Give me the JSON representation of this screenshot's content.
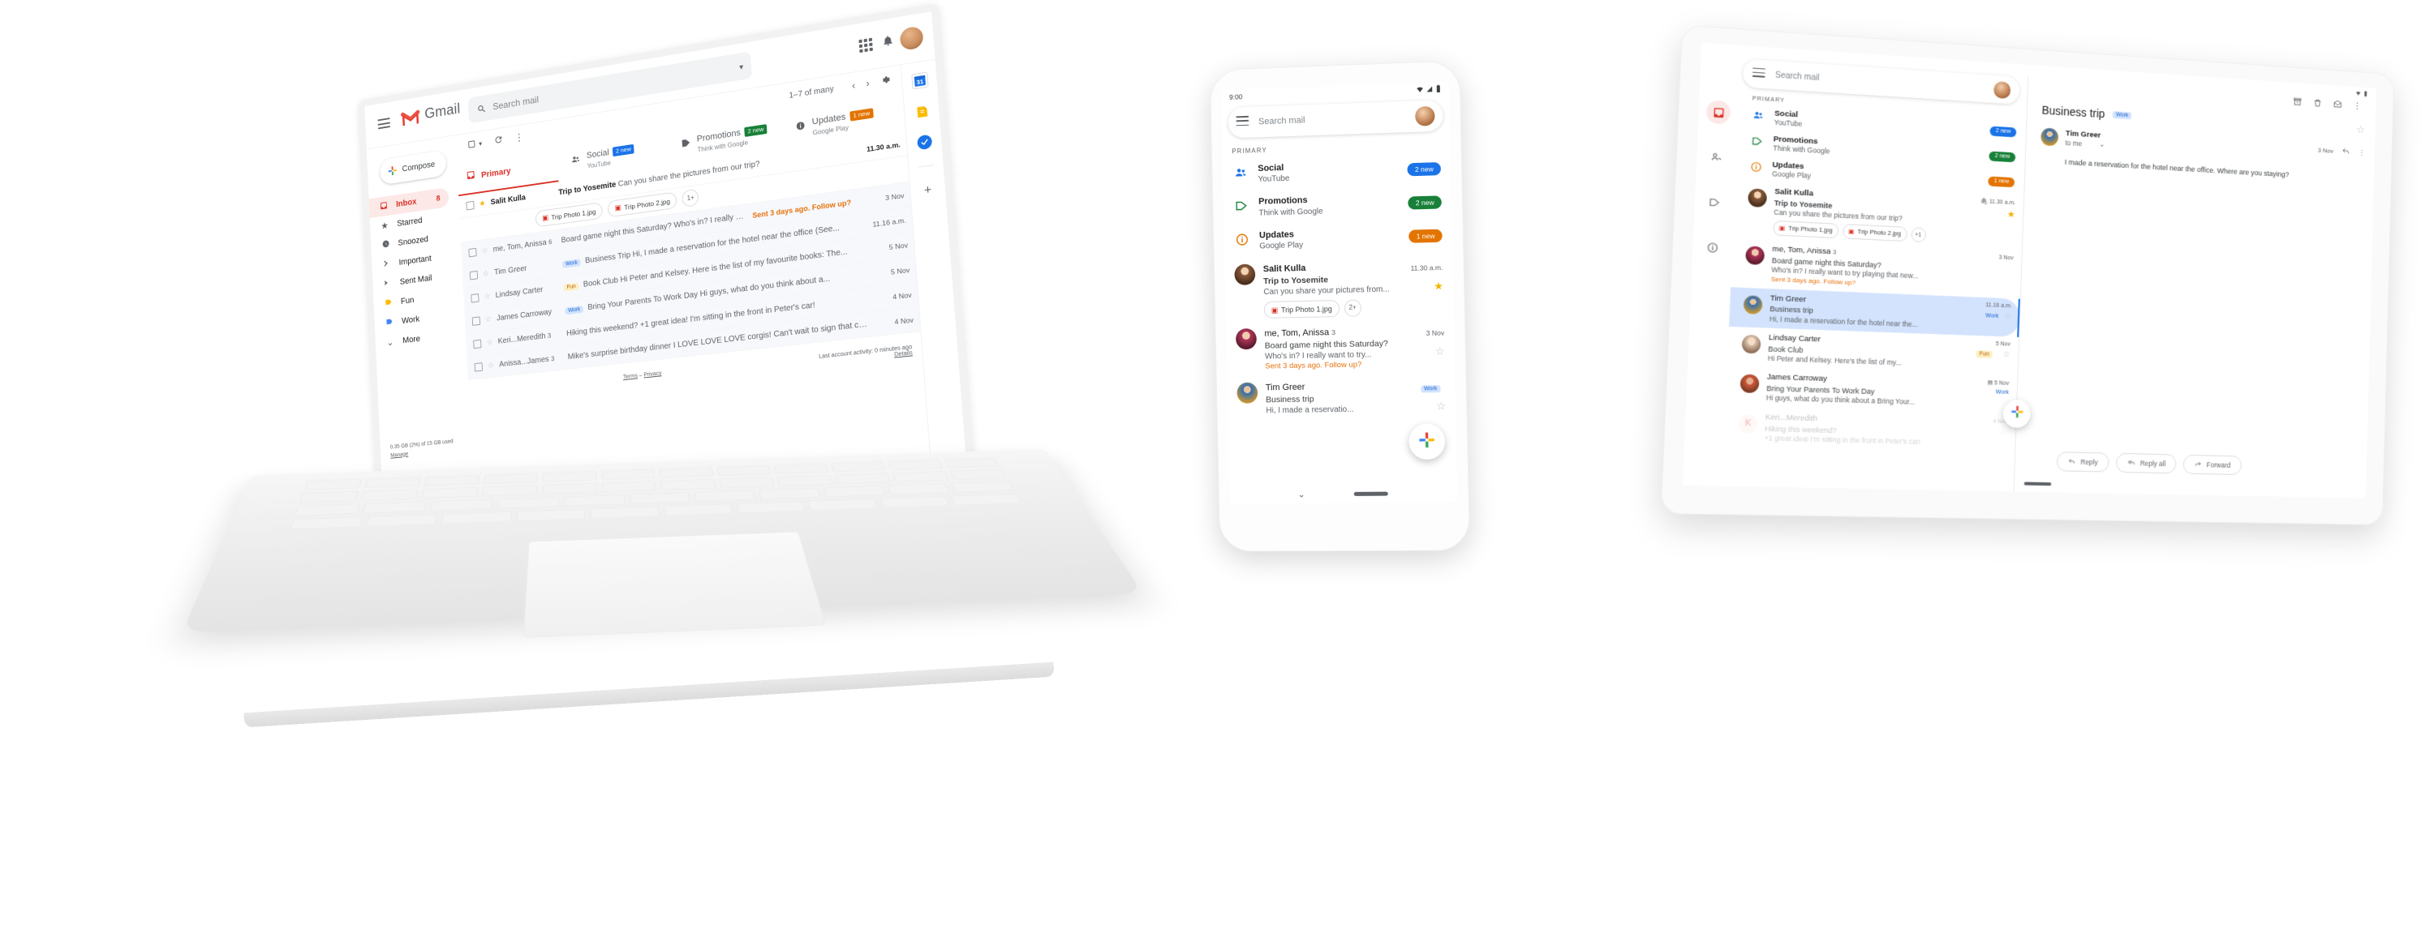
{
  "brand": {
    "app_name": "Gmail",
    "colors": {
      "red": "#d93025",
      "blue": "#1a73e8",
      "green": "#188038",
      "orange": "#e37400",
      "yellow": "#f4b400",
      "nudge_orange": "#e8710a",
      "work_label_bg": "#d3e3fd",
      "work_label_fg": "#1967d2",
      "fun_label_bg": "#feefc3",
      "fun_label_fg": "#b06000"
    }
  },
  "desktop": {
    "search": {
      "placeholder": "Search mail",
      "icon": "search-icon"
    },
    "menu_icon": "hamburger-menu-icon",
    "apps_icon": "apps-grid-icon",
    "notifications_icon": "bell-icon",
    "account_avatar": "user-avatar",
    "compose": {
      "label": "Compose",
      "icon": "plus-icon"
    },
    "sidebar": [
      {
        "label": "Inbox",
        "icon": "inbox-icon",
        "count": "8",
        "active": true
      },
      {
        "label": "Starred",
        "icon": "star-icon",
        "count": ""
      },
      {
        "label": "Snoozed",
        "icon": "clock-icon",
        "count": ""
      },
      {
        "label": "Important",
        "icon": "important-icon",
        "count": ""
      },
      {
        "label": "Sent Mail",
        "icon": "send-icon",
        "count": ""
      },
      {
        "label": "Fun",
        "icon": "label-yellow-icon",
        "count": ""
      },
      {
        "label": "Work",
        "icon": "label-blue-icon",
        "count": ""
      },
      {
        "label": "More",
        "icon": "chevron-down-icon",
        "count": ""
      }
    ],
    "storage": {
      "text": "0.35 GB (2%) of 15 GB used",
      "manage": "Manage"
    },
    "footer_icons": [
      "contacts-icon",
      "location-icon",
      "phone-icon"
    ],
    "toolbar": {
      "select_icon": "select-all-checkbox-icon",
      "select_caret": "chevron-down-icon",
      "refresh_icon": "refresh-icon",
      "more_icon": "more-vertical-icon",
      "count": "1–7 of many",
      "prev_icon": "chevron-left-icon",
      "next_icon": "chevron-right-icon",
      "settings_icon": "gear-icon"
    },
    "tabs": [
      {
        "label": "Primary",
        "sub": "",
        "badge": "",
        "badge_color": "",
        "icon": "inbox-icon",
        "selected": true
      },
      {
        "label": "Social",
        "sub": "YouTube",
        "badge": "2 new",
        "badge_color": "#1a73e8",
        "icon": "people-icon",
        "selected": false
      },
      {
        "label": "Promotions",
        "sub": "Think with Google",
        "badge": "2 new",
        "badge_color": "#188038",
        "icon": "tag-icon",
        "selected": false
      },
      {
        "label": "Updates",
        "sub": "Google Play",
        "badge": "1 new",
        "badge_color": "#e37400",
        "icon": "info-icon",
        "selected": false
      }
    ],
    "threads": [
      {
        "from": "Salit Kulla",
        "count": "",
        "starred": true,
        "unread": true,
        "label": "",
        "subject": "Trip to Yosemite",
        "snippet": "Can you share the pictures from our trip?",
        "date": "11.30 a.m.",
        "nudge": "",
        "attachments": [
          "Trip Photo 1.jpg",
          "Trip Photo 2.jpg"
        ],
        "attachments_more": "1+"
      },
      {
        "from": "me, Tom, Anissa",
        "count": "6",
        "starred": false,
        "unread": false,
        "label": "",
        "subject": "Board game night this Saturday?",
        "snippet": "Who's in? I really want to try...",
        "date": "3 Nov",
        "nudge": "Sent 3 days ago. Follow up?",
        "attachments": [],
        "attachments_more": ""
      },
      {
        "from": "Tim Greer",
        "count": "",
        "starred": false,
        "unread": false,
        "label": "Work",
        "subject": "Business Trip",
        "snippet": "Hi, I made a reservation for the hotel near the office (See...",
        "date": "11.16 a.m.",
        "nudge": "",
        "attachments": [],
        "attachments_more": ""
      },
      {
        "from": "Lindsay Carter",
        "count": "",
        "starred": false,
        "unread": false,
        "label": "Fun",
        "subject": "Book Club",
        "snippet": "Hi Peter and Kelsey. Here is the list of my favourite books: The...",
        "date": "5 Nov",
        "nudge": "",
        "attachments": [],
        "attachments_more": ""
      },
      {
        "from": "James Carroway",
        "count": "",
        "starred": false,
        "unread": false,
        "label": "Work",
        "subject": "Bring Your Parents To Work Day",
        "snippet": "Hi guys, what do you think about a...",
        "date": "5 Nov",
        "nudge": "",
        "attachments": [],
        "attachments_more": ""
      },
      {
        "from": "Keri...Meredith",
        "count": "3",
        "starred": false,
        "unread": false,
        "label": "",
        "subject": "Hiking this weekend?",
        "snippet": "+1 great idea! I'm sitting in the front in Peter's car!",
        "date": "4 Nov",
        "nudge": "",
        "attachments": [],
        "attachments_more": ""
      },
      {
        "from": "Anissa...James",
        "count": "3",
        "starred": false,
        "unread": false,
        "label": "",
        "subject": "Mike's surprise birthday dinner",
        "snippet": "I LOVE LOVE LOVE corgis! Can't wait to sign that card.",
        "date": "4 Nov",
        "nudge": "",
        "attachments": [],
        "attachments_more": ""
      }
    ],
    "list_footer": {
      "terms": "Terms",
      "separator": "–",
      "privacy": "Privacy",
      "activity": "Last account activity: 0 minutes ago",
      "details": "Details"
    },
    "side_panel": [
      {
        "icon": "google-calendar-icon",
        "label": "31"
      },
      {
        "icon": "google-keep-icon",
        "label": ""
      },
      {
        "icon": "google-tasks-icon",
        "label": ""
      }
    ],
    "side_panel_add": {
      "icon": "plus-icon",
      "label": "+"
    }
  },
  "phone": {
    "status": {
      "time": "9:00",
      "wifi": "wifi-icon",
      "signal": "signal-icon",
      "battery": "battery-icon"
    },
    "search": {
      "placeholder": "Search mail",
      "menu_icon": "hamburger-menu-icon",
      "avatar": "user-avatar"
    },
    "section": "PRIMARY",
    "bundles": [
      {
        "name": "Social",
        "sender": "YouTube",
        "badge": "2 new",
        "color": "#1a73e8",
        "icon": "people-icon"
      },
      {
        "name": "Promotions",
        "sender": "Think with Google",
        "badge": "2 new",
        "color": "#188038",
        "icon": "tag-icon"
      },
      {
        "name": "Updates",
        "sender": "Google Play",
        "badge": "1 new",
        "color": "#e37400",
        "icon": "info-icon"
      }
    ],
    "threads": [
      {
        "from": "Salit Kulla",
        "count": "",
        "subject": "Trip to Yosemite",
        "snippet": "Can you share your pictures from...",
        "date": "11.30 a.m.",
        "starred": true,
        "unread": true,
        "nudge": "",
        "label": "",
        "attachments": [
          "Trip Photo 1.jpg"
        ],
        "attachments_more": "2+"
      },
      {
        "from": "me, Tom, Anissa",
        "count": "3",
        "subject": "Board game night this Saturday?",
        "snippet": "Who's in? I really want to try...",
        "date": "3 Nov",
        "starred": false,
        "unread": false,
        "nudge": "Sent 3 days ago. Follow up?",
        "label": "",
        "attachments": [],
        "attachments_more": ""
      },
      {
        "from": "Tim Greer",
        "count": "",
        "subject": "Business trip",
        "snippet": "Hi, I made a reservatio...",
        "date": "",
        "starred": false,
        "unread": false,
        "nudge": "",
        "label": "Work",
        "attachments": [],
        "attachments_more": ""
      }
    ],
    "fab": {
      "icon": "compose-plus-icon"
    },
    "nav": {
      "chevron": "chevron-down-icon",
      "home_indicator": "home-pill"
    }
  },
  "tablet": {
    "search": {
      "placeholder": "Search mail",
      "menu_icon": "hamburger-menu-icon",
      "avatar": "user-avatar"
    },
    "rail": [
      "inbox-icon",
      "people-icon",
      "tag-icon",
      "info-icon"
    ],
    "section": "PRIMARY",
    "bundles": [
      {
        "name": "Social",
        "sender": "YouTube",
        "badge": "2 new",
        "color": "#1a73e8",
        "icon": "people-icon"
      },
      {
        "name": "Promotions",
        "sender": "Think with Google",
        "badge": "2 new",
        "color": "#188038",
        "icon": "tag-icon"
      },
      {
        "name": "Updates",
        "sender": "Google Play",
        "badge": "1 new",
        "color": "#e37400",
        "icon": "info-icon"
      }
    ],
    "threads": [
      {
        "from": "Salit Kulla",
        "count": "",
        "subject": "Trip to Yosemite",
        "snippet": "Can you share the pictures from our trip?",
        "date": "11.30 a.m.",
        "starred": true,
        "unread": true,
        "selected": false,
        "nudge": "",
        "label": "",
        "attachments": [
          "Trip Photo 1.jpg",
          "Trip Photo 2.jpg"
        ],
        "attachments_more": "+1",
        "attach_icon": "paperclip-icon"
      },
      {
        "from": "me, Tom, Anissa",
        "count": "3",
        "subject": "Board game night this Saturday?",
        "snippet": "Who's in? I really want to try playing that new...",
        "date": "3 Nov",
        "starred": false,
        "unread": false,
        "selected": false,
        "nudge": "Sent 3 days ago. Follow up?",
        "label": "",
        "attachments": [],
        "attachments_more": "",
        "attach_icon": ""
      },
      {
        "from": "Tim Greer",
        "count": "",
        "subject": "Business trip",
        "snippet": "Hi, I made a reservation for the hotel near the...",
        "date": "11.16 a.m.",
        "starred": false,
        "unread": false,
        "selected": true,
        "nudge": "",
        "label": "Work",
        "attachments": [],
        "attachments_more": "",
        "attach_icon": ""
      },
      {
        "from": "Lindsay Carter",
        "count": "",
        "subject": "Book Club",
        "snippet": "Hi Peter and Kelsey. Here's the list of my...",
        "date": "5 Nov",
        "starred": false,
        "unread": false,
        "selected": false,
        "nudge": "",
        "label": "Fun",
        "attachments": [],
        "attachments_more": "",
        "attach_icon": ""
      },
      {
        "from": "James Carroway",
        "count": "",
        "subject": "Bring Your Parents To Work Day",
        "snippet": "Hi guys, what do you think about a Bring Your...",
        "date": "5 Nov",
        "starred": false,
        "unread": false,
        "selected": false,
        "nudge": "",
        "label": "Work",
        "attachments": [],
        "attachments_more": "",
        "attach_icon": "calendar-icon"
      },
      {
        "from": "Keri...Meredith",
        "count": "",
        "subject": "Hiking this weekend?",
        "snippet": "+1 great idea! I'm sitting in the front in Peter's car!",
        "date": "4 Nov",
        "starred": false,
        "unread": false,
        "selected": false,
        "nudge": "",
        "label": "",
        "attachments": [],
        "attachments_more": "",
        "attach_icon": ""
      }
    ],
    "reading_pane": {
      "actions": [
        "archive-icon",
        "trash-icon",
        "mark-unread-icon",
        "more-vertical-icon"
      ],
      "subject": "Business trip",
      "label": "Work",
      "star_icon": "star-outline-icon",
      "sender": "Tim Greer",
      "recipient": "to me",
      "expand_icon": "chevron-down-icon",
      "date": "3 Nov",
      "reply_icon": "reply-icon",
      "more_icon": "more-vertical-icon",
      "body": "I made a reservation for the hotel near the office. Where are you staying?",
      "buttons": [
        {
          "label": "Reply",
          "icon": "reply-icon"
        },
        {
          "label": "Reply all",
          "icon": "reply-all-icon"
        },
        {
          "label": "Forward",
          "icon": "forward-icon"
        }
      ]
    },
    "fab": {
      "icon": "compose-plus-icon"
    }
  }
}
